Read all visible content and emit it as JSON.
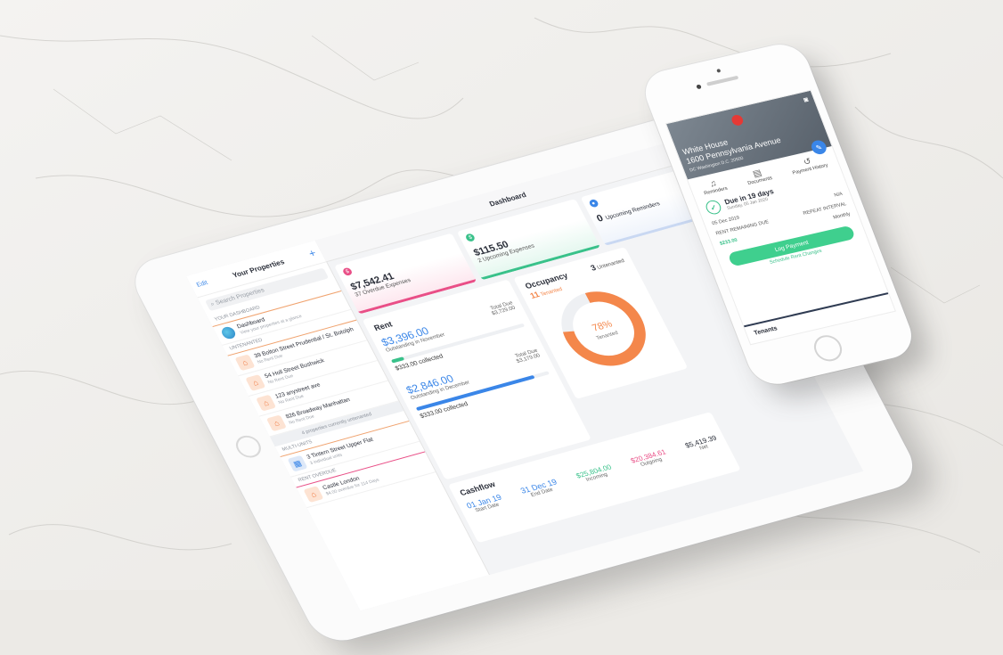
{
  "tablet": {
    "sidebar": {
      "edit": "Edit",
      "title": "Your Properties",
      "plus": "+",
      "search_placeholder": "Search Properties",
      "section_dashboard": "YOUR DASHBOARD",
      "dashboard_item": {
        "name": "Dashboard",
        "sub": "View your properties at a glance"
      },
      "section_untenanted": "UNTENANTED",
      "untenanted": [
        {
          "name": "39 Bolton Street Prudential / St. Botolph",
          "sub": "No Rent Due"
        },
        {
          "name": "54 Holl Street Bushwick",
          "sub": "No Rent Due"
        },
        {
          "name": "123 anystreet ave",
          "sub": "No Rent Due"
        },
        {
          "name": "826 Broadway Manhattan",
          "sub": "No Rent Due"
        }
      ],
      "untenanted_note": "4 properties currently untenanted",
      "section_multi": "MULTI-UNITS",
      "multi": {
        "name": "3 Tintern Street Upper Flat",
        "sub": "3 individual units"
      },
      "section_overdue": "RENT OVERDUE",
      "overdue": {
        "name": "Castle London",
        "sub": "$4.00 overdue for 114 Days"
      }
    },
    "header": {
      "title": "Dashboard",
      "icons": "⇅ ⟳"
    },
    "cards": [
      {
        "amount": "$7,542.41",
        "label": "37 Overdue Expenses",
        "badge_color": "#e94f87",
        "bar_color": "#e94f87",
        "bg": "#fde6ee"
      },
      {
        "amount": "$115.50",
        "label": "2 Upcoming Expenses",
        "badge_color": "#39c18a",
        "bar_color": "#39c18a",
        "bg": "#e3f7ee"
      },
      {
        "amount": "0",
        "label": "Upcoming Reminders",
        "badge_color": "#3a86e8",
        "bar_color": "#c9d8f2",
        "bg": "#eef3fb"
      }
    ],
    "rent": {
      "title": "Rent",
      "nov": {
        "amount": "$3,396.00",
        "label": "Outstanding in November",
        "total_label": "Total Due",
        "total": "$3,729.00",
        "collected": "$333.00 collected",
        "fraction": 0.09,
        "color": "#39c18a"
      },
      "dec": {
        "amount": "$2,846.00",
        "label": "Outstanding in December",
        "total_label": "Total Due",
        "total": "$3,179.00",
        "collected": "$333.00 collected",
        "fraction": 0.89,
        "color": "#3a86e8"
      }
    },
    "occupancy": {
      "title": "Occupancy",
      "tenanted_count": "11",
      "tenanted_label": "Tenanted",
      "untenanted_count": "3",
      "untenanted_label": "Untenanted",
      "percent": 78,
      "percent_label": "78%",
      "center_label": "Tenanted",
      "color": "#f4874b"
    },
    "cashflow": {
      "title": "Cashflow",
      "start": "01 Jan 19",
      "start_label": "Start Date",
      "end": "31 Dec 19",
      "end_label": "End Date",
      "incoming": "$25,804.00",
      "incoming_label": "Incoming",
      "outgoing": "$20,384.61",
      "outgoing_label": "Outgoing",
      "net": "$5,419.39",
      "net_label": "Net"
    }
  },
  "phone": {
    "address1": "White House",
    "address2": "1600 Pennsylvania Avenue",
    "address3": "DC Washington D.C. 20500",
    "tabs": [
      {
        "label": "Reminders",
        "icon": "bell-icon"
      },
      {
        "label": "Documents",
        "icon": "document-icon"
      },
      {
        "label": "Payment History",
        "icon": "history-icon"
      }
    ],
    "due_title": "Due in 19 days",
    "due_date": "Sunday, 05 Jan 2020",
    "date_from": "05 Dec 2019",
    "date_to": "N/A",
    "repeat_label": "REPEAT INTERVAL",
    "repeat_value": "Monthly",
    "remaining_label": "RENT REMAINING DUE",
    "remaining_value": "$233.00",
    "log_button": "Log Payment",
    "schedule_link": "Schedule Rent Changes",
    "tenants": "Tenants"
  }
}
